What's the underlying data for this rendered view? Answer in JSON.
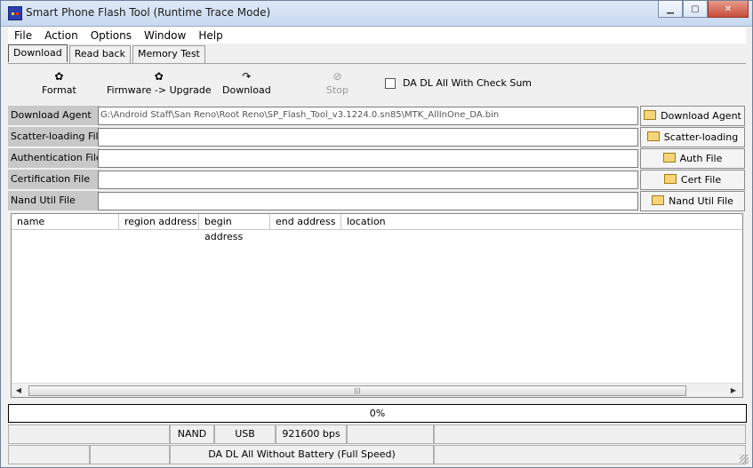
{
  "window": {
    "title": "Smart Phone Flash Tool (Runtime Trace Mode)",
    "controls": [
      "▁",
      "▢",
      "✕"
    ]
  },
  "menu": [
    "File",
    "Action",
    "Options",
    "Window",
    "Help"
  ],
  "tabs": [
    "Download",
    "Read back",
    "Memory Test"
  ],
  "toolbar": {
    "format": "Format",
    "firmware_upgrade": "Firmware -> Upgrade",
    "download": "Download",
    "stop": "Stop",
    "checksum_label": "DA DL All With Check Sum",
    "checksum_checked": false
  },
  "fields": {
    "download_agent": {
      "label": "Download Agent",
      "value": "G:\\Android Staff\\San Reno\\Root Reno\\SP_Flash_Tool_v3.1224.0.sn85\\MTK_AllInOne_DA.bin",
      "button": "Download Agent"
    },
    "scatter": {
      "label": "Scatter-loading File",
      "value": "",
      "button": "Scatter-loading"
    },
    "auth": {
      "label": "Authentication File",
      "value": "",
      "button": "Auth File"
    },
    "cert": {
      "label": "Certification File",
      "value": "",
      "button": "Cert File"
    },
    "nand": {
      "label": "Nand Util File",
      "value": "",
      "button": "Nand Util File"
    }
  },
  "table": {
    "columns": [
      "name",
      "region address",
      "begin address",
      "end address",
      "location"
    ],
    "rows": []
  },
  "progress": {
    "text": "0%",
    "fraction": 0
  },
  "statusbar": {
    "storage": "NAND",
    "port": "USB",
    "baud": "921600 bps",
    "mode": "DA DL All Without Battery (Full Speed)"
  }
}
